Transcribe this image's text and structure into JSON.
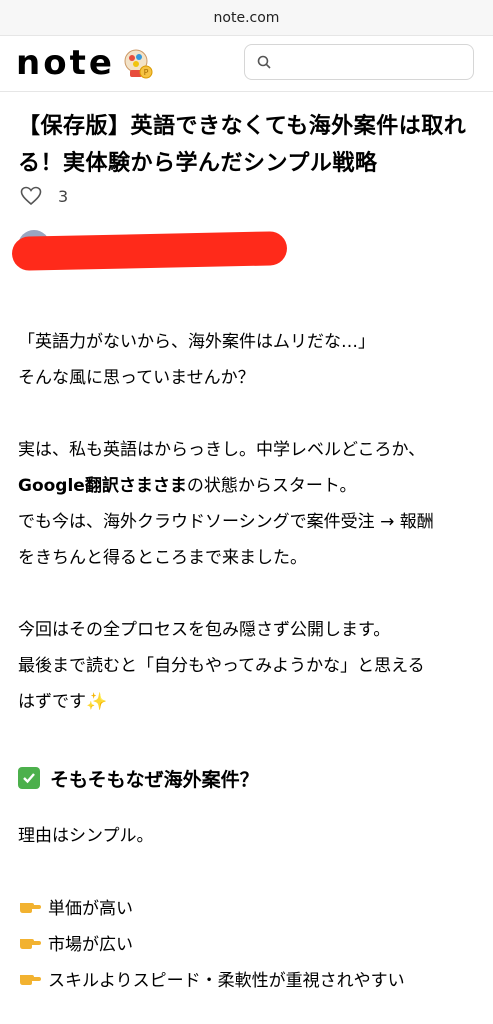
{
  "browser": {
    "url": "note.com"
  },
  "header": {
    "logo": "note",
    "search_placeholder": ""
  },
  "article": {
    "title": "【保存版】英語できなくても海外案件は取れる！実体験から学んだシンプル戦略",
    "like_count": "3",
    "paragraph1": [
      "「英語力がないから、海外案件はムリだな…」",
      "そんな風に思っていませんか？"
    ],
    "paragraph2_line1": "実は、私も英語はからっきし。中学レベルどころか、",
    "paragraph2_bold": "Google翻訳さまさま",
    "paragraph2_rest": "の状態からスタート。",
    "paragraph2_line3": "でも今は、海外クラウドソーシングで案件受注 → 報酬",
    "paragraph2_line4": "をきちんと得るところまで来ました。",
    "paragraph3": [
      "今回はその全プロセスを包み隠さず公開します。",
      "最後まで読むと「自分もやってみようかな」と思える",
      "はずです✨"
    ],
    "heading": "そもそもなぜ海外案件？",
    "paragraph4": "理由はシンプル。",
    "bullets": [
      "単価が高い",
      "市場が広い",
      "スキルよりスピード・柔軟性が重視されやすい"
    ]
  },
  "colors": {
    "redaction": "#ff2a1a",
    "check": "#4cb04c",
    "finger": "#f2b230"
  }
}
